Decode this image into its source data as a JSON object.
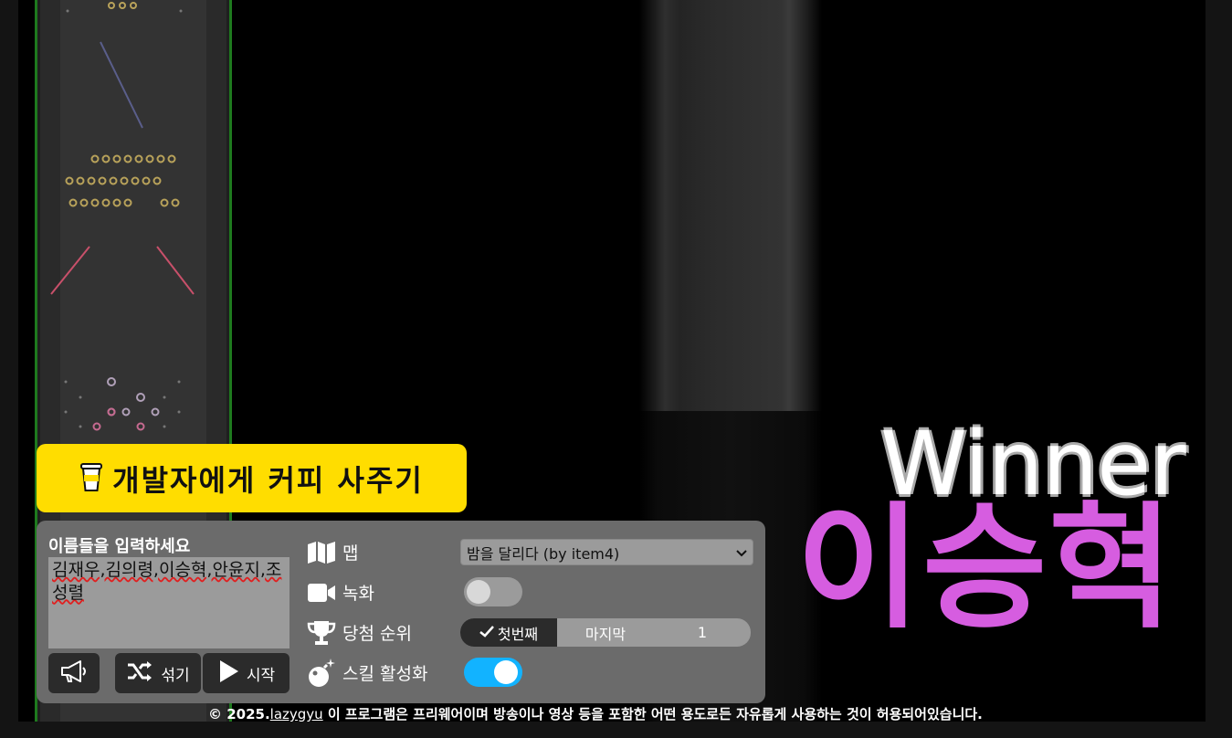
{
  "coffee": {
    "label": "개발자에게 커피 사주기",
    "icon": "coffee-cup-icon",
    "color": "#ffdd00"
  },
  "winner": {
    "heading": "Winner",
    "name": "이승혁",
    "name_color": "#d65de0"
  },
  "panel": {
    "names_title": "이름들을 입력하세요",
    "names_value": "김재우,김의령,이승혁,안윤지,조성렬",
    "buttons": {
      "announce_icon": "megaphone-icon",
      "shuffle_label": "섞기",
      "shuffle_icon": "shuffle-icon",
      "start_label": "시작",
      "start_icon": "play-icon"
    },
    "map": {
      "label": "맵",
      "icon": "map-icon",
      "selected": "밤을 달리다 (by item4)"
    },
    "record": {
      "label": "녹화",
      "icon": "video-camera-icon",
      "enabled": false
    },
    "rank": {
      "label": "당첨 순위",
      "icon": "trophy-icon",
      "options": [
        "첫번째",
        "마지막"
      ],
      "selected": "첫번째",
      "value": "1"
    },
    "skill": {
      "label": "스킬 활성화",
      "icon": "bomb-sparkle-icon",
      "enabled": true,
      "accent": "#12b3ff"
    }
  },
  "footer": {
    "prefix": "© 2025.",
    "link": "lazygyu",
    "text": " 이 프로그램은 프리웨어이며 방송이나 영상 등을 포함한 어떤 용도로든 자유롭게 사용하는 것이 허용되어있습니다."
  }
}
